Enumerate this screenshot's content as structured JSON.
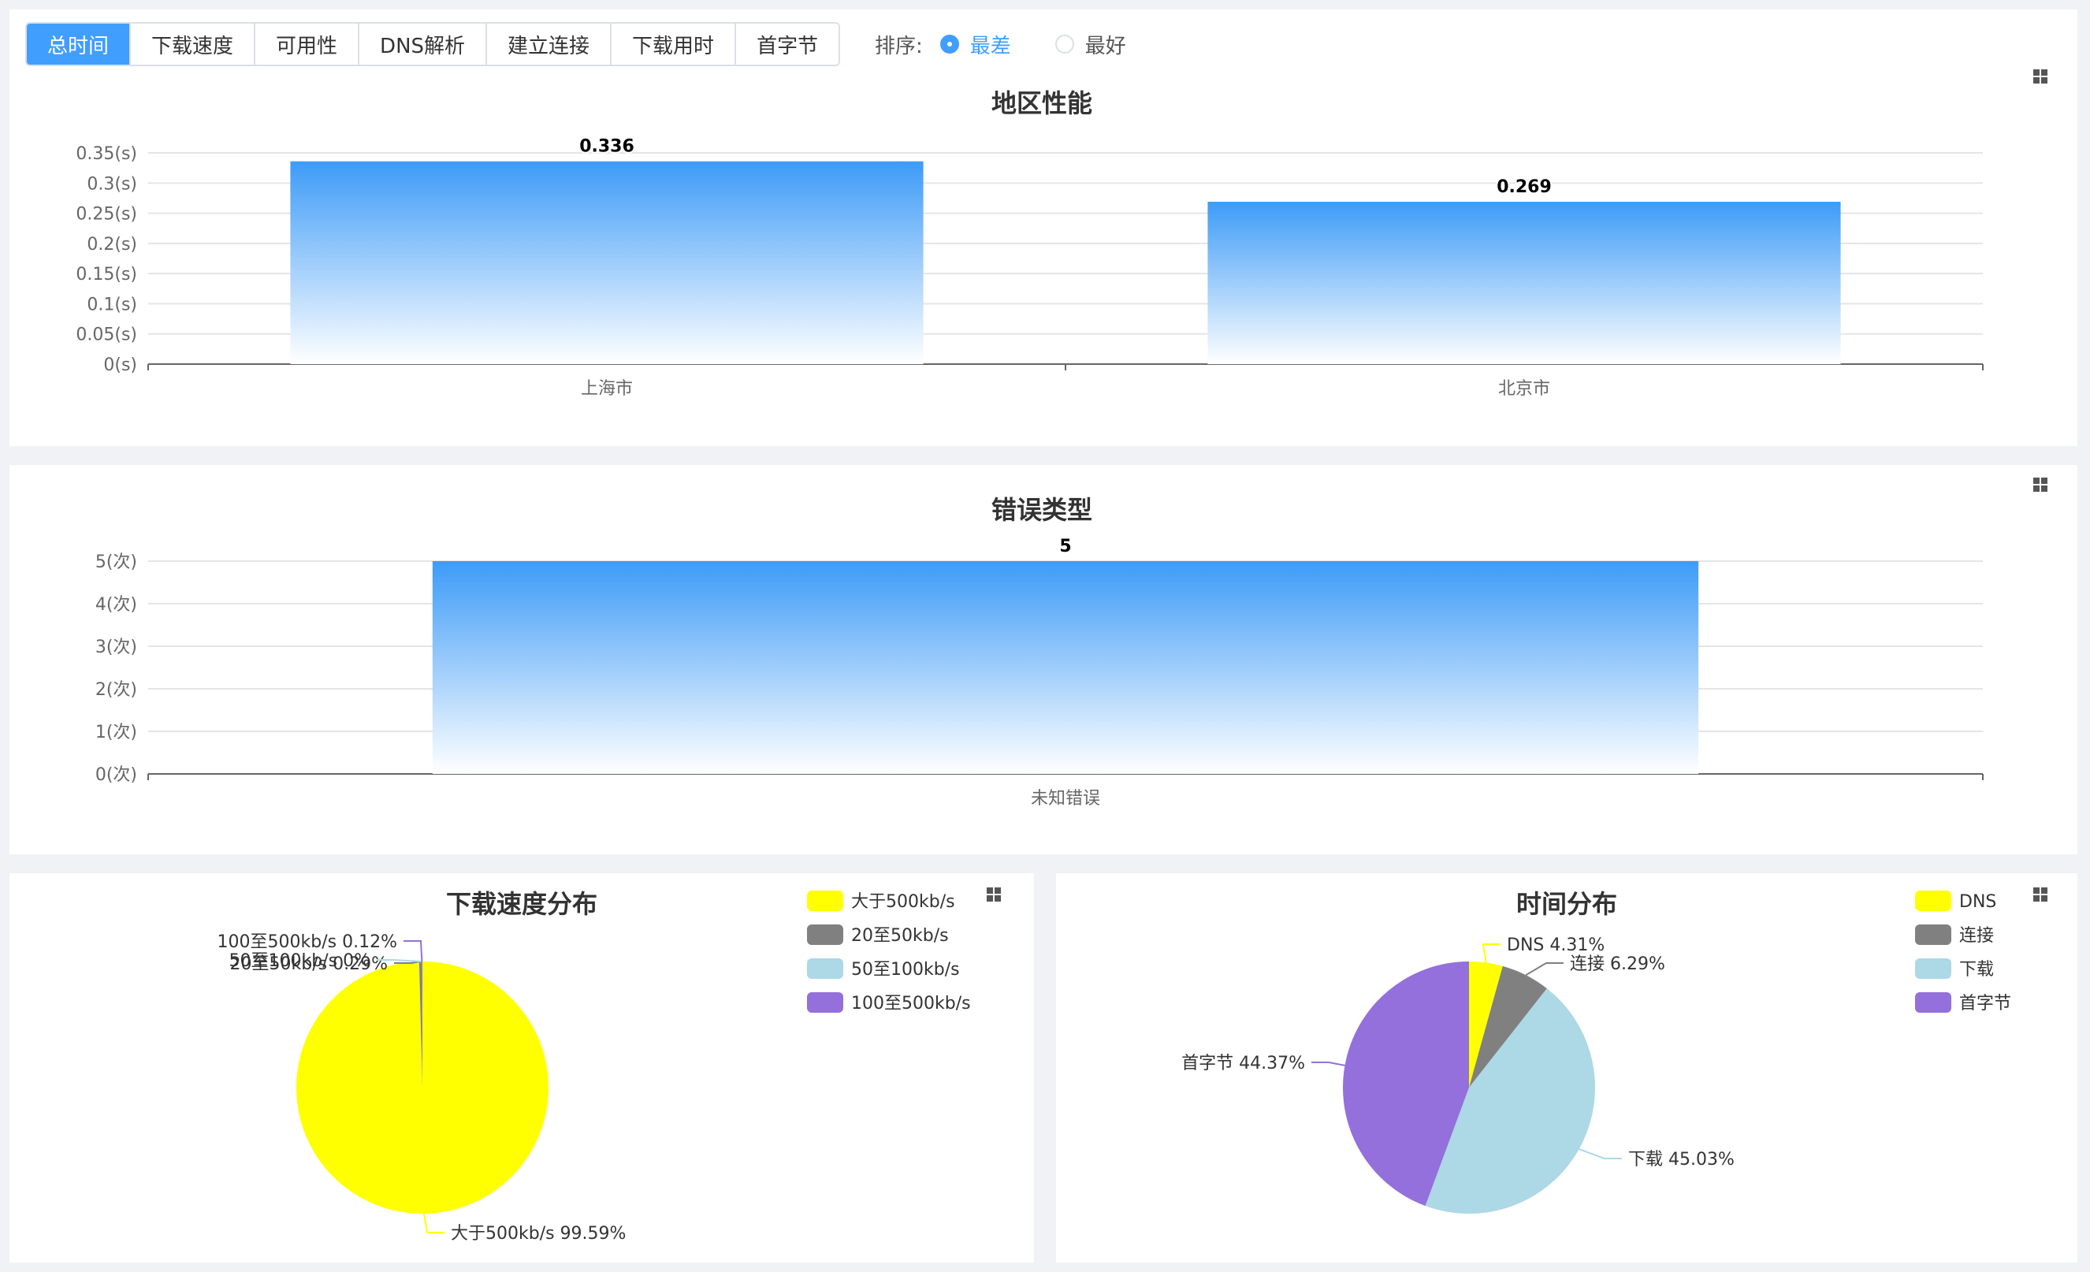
{
  "tabs": [
    "总时间",
    "下载速度",
    "可用性",
    "DNS解析",
    "建立连接",
    "下载用时",
    "首字节"
  ],
  "active_tab": 0,
  "sort": {
    "label": "排序:",
    "options": [
      "最差",
      "最好"
    ],
    "selected": 0
  },
  "colors": {
    "accent": "#409eff",
    "bar_top": "#3d9bf7",
    "pie": [
      "#ffff00",
      "#808080",
      "#add8e6",
      "#9370db"
    ]
  },
  "chart_data": [
    {
      "type": "bar",
      "title": "地区性能",
      "categories": [
        "上海市",
        "北京市"
      ],
      "values": [
        0.336,
        0.269
      ],
      "value_labels": [
        "0.336",
        "0.269"
      ],
      "yticks": [
        "0(s)",
        "0.05(s)",
        "0.1(s)",
        "0.15(s)",
        "0.2(s)",
        "0.25(s)",
        "0.3(s)",
        "0.35(s)"
      ],
      "ylim": [
        0,
        0.35
      ],
      "grid": true
    },
    {
      "type": "bar",
      "title": "错误类型",
      "categories": [
        "未知错误"
      ],
      "values": [
        5
      ],
      "value_labels": [
        "5"
      ],
      "yticks": [
        "0(次)",
        "1(次)",
        "2(次)",
        "3(次)",
        "4(次)",
        "5(次)"
      ],
      "ylim": [
        0,
        5
      ],
      "grid": true
    },
    {
      "type": "pie",
      "title": "下载速度分布",
      "legend": [
        "大于500kb/s",
        "20至50kb/s",
        "50至100kb/s",
        "100至500kb/s"
      ],
      "legend_position": "top-right",
      "slices": [
        {
          "name": "大于500kb/s",
          "value": 99.59,
          "label": "大于500kb/s 99.59%"
        },
        {
          "name": "20至50kb/s",
          "value": 0.29,
          "label": "20至50kb/s 0.29%"
        },
        {
          "name": "50至100kb/s",
          "value": 0,
          "label": "50至100kb/s 0%"
        },
        {
          "name": "100至500kb/s",
          "value": 0.12,
          "label": "100至500kb/s 0.12%"
        }
      ]
    },
    {
      "type": "pie",
      "title": "时间分布",
      "legend": [
        "DNS",
        "连接",
        "下载",
        "首字节"
      ],
      "legend_position": "top-right",
      "slices": [
        {
          "name": "DNS",
          "value": 4.31,
          "label": "DNS 4.31%"
        },
        {
          "name": "连接",
          "value": 6.29,
          "label": "连接 6.29%"
        },
        {
          "name": "下载",
          "value": 45.03,
          "label": "下载 45.03%"
        },
        {
          "name": "首字节",
          "value": 44.37,
          "label": "首字节 44.37%"
        }
      ]
    }
  ]
}
